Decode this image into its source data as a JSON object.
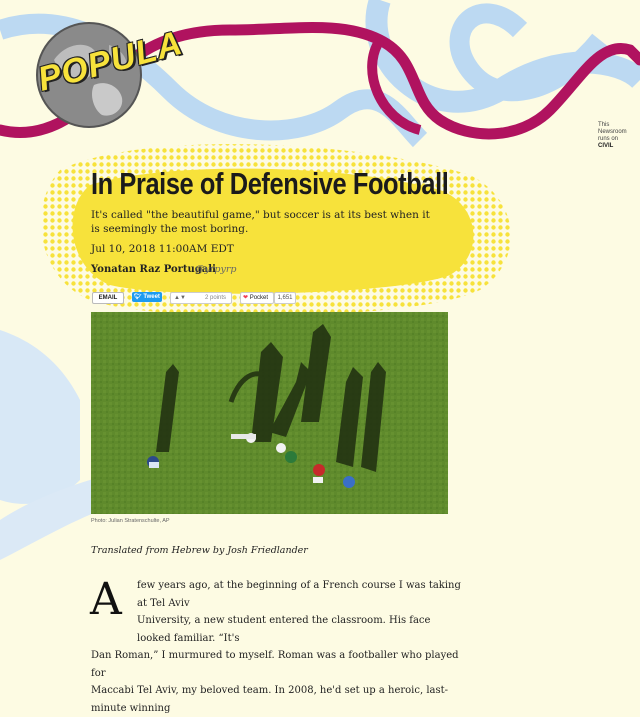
{
  "site": {
    "logo_text": "POPULA",
    "civil_lines": [
      "This",
      "Newsroom",
      "runs on",
      "CIVIL"
    ]
  },
  "article": {
    "title": "In Praise of Defensive Football",
    "subtitle": "It's called \"the beautiful game,\" but soccer is at its best when it is seemingly the most boring.",
    "date": "Jul 10, 2018 11:00AM EDT",
    "author": "Yonatan Raz Portugali",
    "handle": "@yrpyrp"
  },
  "share": {
    "email": "EMAIL",
    "tweet": "Tweet",
    "reddit_points": "2 points",
    "pocket": "Pocket",
    "pocket_count": "1,651"
  },
  "photo": {
    "caption": "Photo: Julian Stratenschulte, AP"
  },
  "body": {
    "translated": "Translated from Hebrew by Josh Friedlander",
    "dropcap": "A",
    "line1": "few years ago, at the beginning of a French course I was taking at Tel Aviv",
    "line2": "University, a new student entered the classroom. His face looked familiar. “It's",
    "line3": "Dan Roman,” I murmured to myself. Roman was a footballer who played for",
    "line4": "Maccabi Tel Aviv, my beloved team. In 2008, he'd set up a heroic, last-minute winning"
  },
  "colors": {
    "background": "#fdfbe3",
    "accent_yellow": "#f7e23b",
    "ribbon_magenta": "#b0135f",
    "river_blue": "#bcd9f2",
    "grass": "#5f8a2c"
  }
}
